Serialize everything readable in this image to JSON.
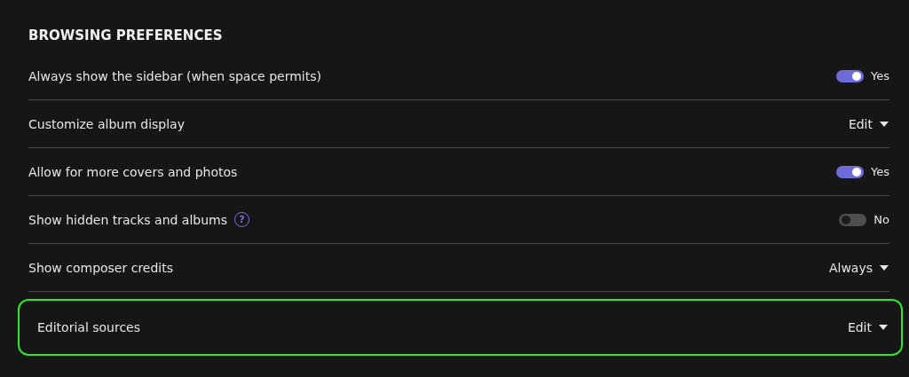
{
  "section_title": "BROWSING PREFERENCES",
  "settings": [
    {
      "kind": "toggle",
      "label": "Always show the sidebar (when space permits)",
      "on": true,
      "value": "Yes",
      "highlighted": false
    },
    {
      "kind": "dropdown",
      "label": "Customize album display",
      "value": "Edit",
      "highlighted": false
    },
    {
      "kind": "toggle",
      "label": "Allow for more covers and photos",
      "on": true,
      "value": "Yes",
      "highlighted": false
    },
    {
      "kind": "toggle",
      "label": "Show hidden tracks and albums",
      "help": "?",
      "on": false,
      "value": "No",
      "highlighted": false
    },
    {
      "kind": "dropdown",
      "label": "Show composer credits",
      "value": "Always",
      "highlighted": false
    },
    {
      "kind": "dropdown",
      "label": "Editorial sources",
      "value": "Edit",
      "highlighted": true
    }
  ]
}
